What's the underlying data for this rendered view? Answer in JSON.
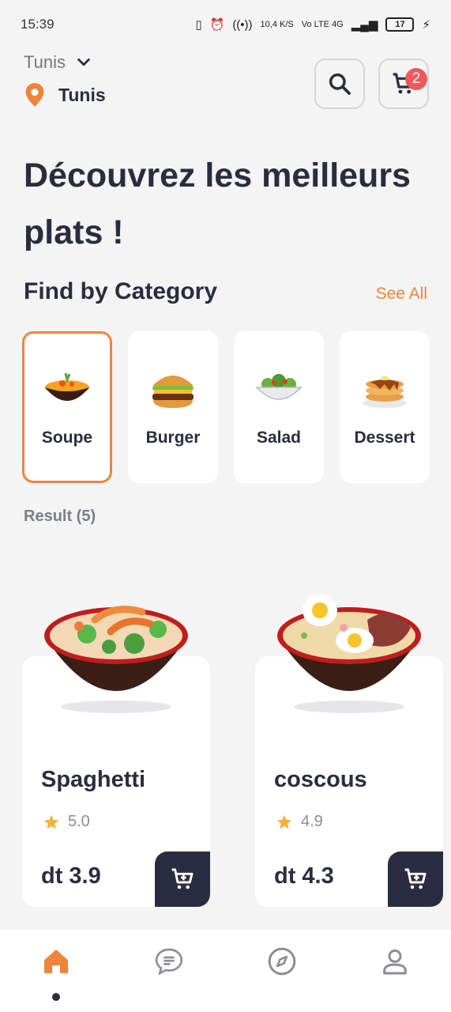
{
  "status_bar": {
    "time": "15:39",
    "net_speed": "10,4 K/S",
    "network": "Vo LTE 4G",
    "battery": "17"
  },
  "location": {
    "city_select": "Tunis",
    "current": "Tunis"
  },
  "cart": {
    "badge_count": "2"
  },
  "headline": "Découvrez les meilleurs plats !",
  "categories_section": {
    "title": "Find by Category",
    "see_all": "See All",
    "items": [
      {
        "label": "Soupe",
        "icon": "soup-bowl-icon",
        "selected": true
      },
      {
        "label": "Burger",
        "icon": "burger-icon",
        "selected": false
      },
      {
        "label": "Salad",
        "icon": "salad-icon",
        "selected": false
      },
      {
        "label": "Dessert",
        "icon": "pancakes-icon",
        "selected": false
      }
    ]
  },
  "result_label": "Result (5)",
  "products": [
    {
      "name": "Spaghetti",
      "rating": "5.0",
      "price": "dt 3.9",
      "image": "noodle-bowl-image"
    },
    {
      "name": "coscous",
      "rating": "4.9",
      "price": "dt 4.3",
      "image": "ramen-bowl-image"
    }
  ],
  "bottom_nav": {
    "items": [
      "home-icon",
      "chat-icon",
      "compass-icon",
      "profile-icon"
    ],
    "active": "home-icon"
  },
  "colors": {
    "accent": "#f0843a",
    "dark": "#2a2d3f",
    "badge": "#ee5a5a",
    "background": "#f4f4f5",
    "star": "#f2b23c"
  }
}
